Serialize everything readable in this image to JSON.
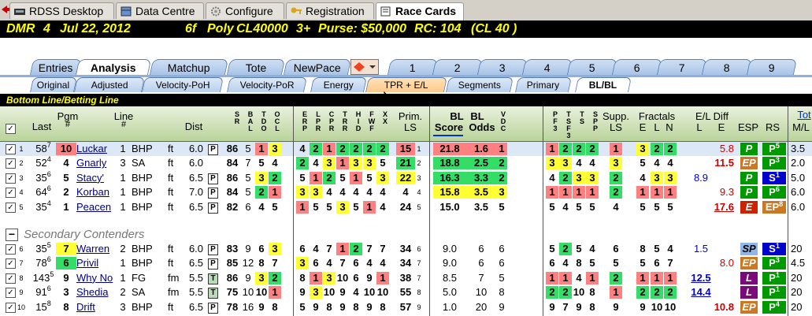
{
  "top_tabs": [
    "RDSS Desktop",
    "Data Centre",
    "Configure",
    "Registration",
    "Race Cards"
  ],
  "race_header": {
    "track": "DMR",
    "race": "4",
    "date": "Jul 22, 2012",
    "distance": "6f",
    "surface": "Poly",
    "class": "CL40000",
    "age": "3+",
    "purse": "Purse: $50,000",
    "rc": "RC: 104",
    "cl": "(CL 40 )"
  },
  "tabs_row1": [
    "Entries",
    "Analysis",
    "Matchup",
    "Tote",
    "NewPace",
    "1",
    "2",
    "3",
    "4",
    "5",
    "6",
    "7",
    "8",
    "9"
  ],
  "tabs_row2": [
    "Original",
    "Adjusted",
    "Velocity-PoH",
    "Velocity-PoR",
    "Energy",
    "TPR + E/L",
    "Segments",
    "Primary",
    "BL/BL"
  ],
  "section_title": "Bottom Line/Betting Line",
  "headers": {
    "last": "Last",
    "pgm": "Pgm",
    "pgm2": "#",
    "line": "Line",
    "line2": "#",
    "dist": "Dist",
    "prim": "Prim.",
    "prim2": "LS",
    "bl1": "BL",
    "bl2": "BL",
    "score": "Score",
    "odds": "Odds",
    "supp": "Supp.",
    "supp2": "LS",
    "fractals": "Fractals",
    "e": "E",
    "l": "L",
    "n": "N",
    "eldiff": "E/L Diff",
    "el_l": "L",
    "el_e": "E",
    "esp": "ESP",
    "rs": "RS",
    "tot": "Tot",
    "ml": "M/L"
  },
  "secondary_label": "Secondary Contenders",
  "main_rows": [
    {
      "n": "1",
      "last": "58",
      "lastsup": "7",
      "pgm": "10",
      "horse": "Luckar",
      "line": "1",
      "surf": "BHP",
      "unit": "ft",
      "dist": "6.0",
      "tag": "P",
      "c1": "86",
      "sbal": "5",
      "tdoc": "1",
      "c4": "3",
      "e1": "4",
      "e2": "2",
      "e3": "1",
      "e4": "2",
      "e5": "2",
      "e6": "2",
      "e7": "2",
      "prim": "15",
      "primsup": "1",
      "score": "21.8",
      "odds": "1.6",
      "vdc": "1",
      "p1": "1",
      "p2": "2",
      "p3": "2",
      "p4": "2",
      "supp": "1",
      "fe": "3",
      "fl": "2",
      "fn": "2",
      "dl": "",
      "de": "5.8",
      "esp": "P",
      "rs": "P",
      "rssup": "5",
      "ml": "3.5"
    },
    {
      "n": "2",
      "last": "52",
      "lastsup": "4",
      "pgm": "4",
      "horse": "Gnarly",
      "line": "3",
      "surf": "SA",
      "unit": "ft",
      "dist": "6.0",
      "tag": "",
      "c1": "84",
      "sbal": "7",
      "tdoc": "5",
      "c4": "4",
      "e1": "2",
      "e2": "4",
      "e3": "3",
      "e4": "1",
      "e5": "3",
      "e6": "3",
      "e7": "5",
      "prim": "21",
      "primsup": "2",
      "score": "18.8",
      "odds": "2.5",
      "vdc": "2",
      "p1": "3",
      "p2": "3",
      "p3": "4",
      "p4": "4",
      "supp": "3",
      "fe": "5",
      "fl": "4",
      "fn": "4",
      "dl": "",
      "de": "11.5",
      "esp": "EP",
      "rs": "P",
      "rssup": "3",
      "ml": "2.0"
    },
    {
      "n": "3",
      "last": "35",
      "lastsup": "6",
      "pgm": "5",
      "horse": "Stacy'",
      "line": "1",
      "surf": "BHP",
      "unit": "ft",
      "dist": "6.5",
      "tag": "P",
      "c1": "86",
      "sbal": "5",
      "tdoc": "3",
      "c4": "2",
      "e1": "5",
      "e2": "1",
      "e3": "2",
      "e4": "5",
      "e5": "1",
      "e6": "5",
      "e7": "3",
      "prim": "22",
      "primsup": "3",
      "score": "16.3",
      "odds": "3.3",
      "vdc": "2",
      "p1": "4",
      "p2": "2",
      "p3": "3",
      "p4": "3",
      "supp": "2",
      "fe": "4",
      "fl": "3",
      "fn": "3",
      "dl": "8.9",
      "de": "",
      "esp": "P",
      "rs": "S",
      "rssup": "1",
      "ml": "5.0"
    },
    {
      "n": "4",
      "last": "64",
      "lastsup": "6",
      "pgm": "2",
      "horse": "Korban",
      "line": "1",
      "surf": "BHP",
      "unit": "ft",
      "dist": "7.0",
      "tag": "P",
      "c1": "84",
      "sbal": "5",
      "tdoc": "2",
      "c4": "1",
      "e1": "3",
      "e2": "3",
      "e3": "4",
      "e4": "4",
      "e5": "4",
      "e6": "4",
      "e7": "4",
      "prim": "4",
      "primsup": "4",
      "score": "15.8",
      "odds": "3.5",
      "vdc": "3",
      "p1": "1",
      "p2": "1",
      "p3": "1",
      "p4": "1",
      "supp": "2",
      "fe": "1",
      "fl": "1",
      "fn": "1",
      "dl": "",
      "de": "9.3",
      "esp": "P",
      "rs": "P",
      "rssup": "6",
      "ml": "6.0"
    },
    {
      "n": "5",
      "last": "35",
      "lastsup": "4",
      "pgm": "1",
      "horse": "Peacen",
      "line": "1",
      "surf": "BHP",
      "unit": "ft",
      "dist": "6.5",
      "tag": "P",
      "c1": "82",
      "sbal": "6",
      "tdoc": "4",
      "c4": "5",
      "e1": "1",
      "e2": "5",
      "e3": "5",
      "e4": "3",
      "e5": "5",
      "e6": "1",
      "e7": "4",
      "prim": "24",
      "primsup": "5",
      "score": "15.0",
      "odds": "3.5",
      "vdc": "5",
      "p1": "5",
      "p2": "4",
      "p3": "5",
      "p4": "5",
      "supp": "4",
      "fe": "5",
      "fl": "5",
      "fn": "5",
      "dl": "",
      "de": "17.6",
      "esp": "E",
      "rs": "EP",
      "rssup": "8",
      "ml": "6.0"
    }
  ],
  "sec_rows": [
    {
      "n": "6",
      "last": "35",
      "lastsup": "5",
      "pgm": "7",
      "horse": "Warren",
      "line": "2",
      "surf": "BHP",
      "unit": "ft",
      "dist": "6.0",
      "tag": "P",
      "c1": "83",
      "sbal": "9",
      "tdoc": "6",
      "c4": "3",
      "e1": "6",
      "e2": "4",
      "e3": "7",
      "e4": "1",
      "e5": "2",
      "e6": "7",
      "e7": "7",
      "prim": "34",
      "primsup": "6",
      "score": "9.0",
      "odds": "6",
      "vdc": "6",
      "p1": "5",
      "p2": "2",
      "p3": "5",
      "p4": "4",
      "supp": "6",
      "fe": "8",
      "fl": "5",
      "fn": "4",
      "dl": "1.5",
      "de": "",
      "esp": "SP",
      "rs": "S",
      "rssup": "1",
      "ml": "20"
    },
    {
      "n": "7",
      "last": "78",
      "lastsup": "6",
      "pgm": "6",
      "horse": "Privil",
      "line": "1",
      "surf": "BHP",
      "unit": "ft",
      "dist": "6.5",
      "tag": "P",
      "c1": "85",
      "sbal": "12",
      "tdoc": "8",
      "c4": "7",
      "e1": "3",
      "e2": "6",
      "e3": "4",
      "e4": "7",
      "e5": "6",
      "e6": "4",
      "e7": "4",
      "prim": "34",
      "primsup": "7",
      "score": "9.0",
      "odds": "6",
      "vdc": "6",
      "p1": "6",
      "p2": "4",
      "p3": "8",
      "p4": "5",
      "supp": "5",
      "fe": "5",
      "fl": "6",
      "fn": "7",
      "dl": "",
      "de": "8.0",
      "esp": "EP",
      "rs": "P",
      "rssup": "3",
      "ml": "4.5"
    },
    {
      "n": "8",
      "last": "143",
      "lastsup": "5",
      "pgm": "9",
      "horse": "Why No",
      "line": "1",
      "surf": "FG",
      "unit": "fm",
      "dist": "5.5",
      "tag": "T",
      "c1": "86",
      "sbal": "9",
      "tdoc": "3",
      "c4": "2",
      "e1": "8",
      "e2": "1",
      "e3": "3",
      "e4": "10",
      "e5": "6",
      "e6": "9",
      "e7": "1",
      "prim": "38",
      "primsup": "7",
      "score": "8.5",
      "odds": "7",
      "vdc": "5",
      "p1": "1",
      "p2": "1",
      "p3": "4",
      "p4": "1",
      "supp": "2",
      "fe": "1",
      "fl": "1",
      "fn": "1",
      "dl": "12.5",
      "de": "",
      "esp": "L",
      "rs": "P",
      "rssup": "1",
      "ml": "20"
    },
    {
      "n": "9",
      "last": "91",
      "lastsup": "6",
      "pgm": "3",
      "horse": "Shedia",
      "line": "2",
      "surf": "SA",
      "unit": "fm",
      "dist": "5.5",
      "tag": "T",
      "c1": "75",
      "sbal": "10",
      "tdoc": "10",
      "c4": "1",
      "e1": "9",
      "e2": "3",
      "e3": "10",
      "e4": "9",
      "e5": "4",
      "e6": "10",
      "e7": "10",
      "prim": "55",
      "primsup": "8",
      "score": "5.0",
      "odds": "10",
      "vdc": "8",
      "p1": "2",
      "p2": "2",
      "p3": "10",
      "p4": "8",
      "supp": "1",
      "fe": "2",
      "fl": "2",
      "fn": "2",
      "dl": "14.4",
      "de": "",
      "esp": "L",
      "rs": "P",
      "rssup": "1",
      "ml": "20"
    },
    {
      "n": "10",
      "last": "15",
      "lastsup": "8",
      "pgm": "8",
      "horse": "Drift",
      "line": "3",
      "surf": "BHP",
      "unit": "ft",
      "dist": "6.5",
      "tag": "P",
      "c1": "78",
      "sbal": "16",
      "tdoc": "9",
      "c4": "8",
      "e1": "5",
      "e2": "9",
      "e3": "8",
      "e4": "9",
      "e5": "8",
      "e6": "9",
      "e7": "8",
      "prim": "57",
      "primsup": "9",
      "score": "1.0",
      "odds": "20",
      "vdc": "9",
      "p1": "9",
      "p2": "7",
      "p3": "9",
      "p4": "8",
      "supp": "9",
      "fe": "9",
      "fl": "10",
      "fn": "10",
      "dl": "",
      "de": "10.8",
      "esp": "EP",
      "rs": "P",
      "rssup": "4",
      "ml": "20"
    }
  ],
  "colors": {
    "green": "#33dd66",
    "yellow": "#ffff33",
    "red": "#ff8080",
    "esp_p": "#009900",
    "esp_ep": "#cc7722",
    "esp_e": "#cc2200",
    "esp_sp": "#8fb8e8",
    "esp_l": "#7a0a7a",
    "rs_p": "#009900",
    "rs_s": "#0000cc",
    "rs_ep": "#cc7722",
    "header_yellow": "#ffff00"
  }
}
